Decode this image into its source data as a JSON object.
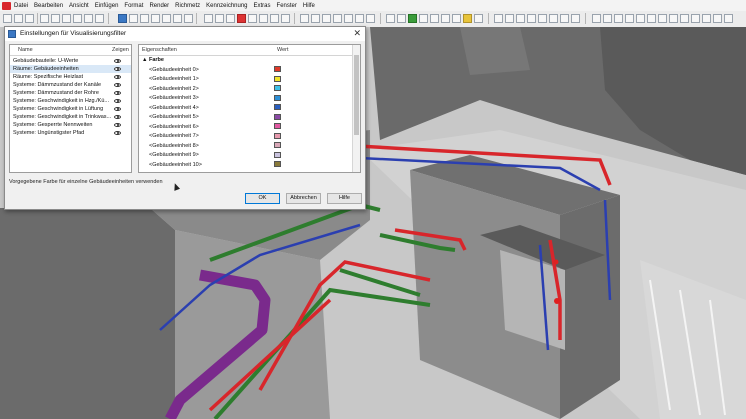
{
  "menu": {
    "items": [
      "Datei",
      "Bearbeiten",
      "Ansicht",
      "Einfügen",
      "Format",
      "Render",
      "Richmetz",
      "Kennzeichnung",
      "Extras",
      "Fenster",
      "Hilfe"
    ]
  },
  "dialog": {
    "title": "Einstellungen für Visualisierungsfilter",
    "close_glyph": "✕",
    "left_panel": {
      "col_name": "Name",
      "col_show": "Zeigen",
      "rows": [
        {
          "label": "Gebäudebauteile: U-Werte",
          "selected": false
        },
        {
          "label": "Räume: Gebäudeeinheiten",
          "selected": true
        },
        {
          "label": "Räume: Spezifische Heizlast",
          "selected": false
        },
        {
          "label": "Systeme: Dämmzustand der Kanäle",
          "selected": false
        },
        {
          "label": "Systeme: Dämmzustand der Rohre",
          "selected": false
        },
        {
          "label": "Systeme: Geschwindigkeit in Hzg./Kü...",
          "selected": false
        },
        {
          "label": "Systeme: Geschwindigkeit in Lüftung",
          "selected": false
        },
        {
          "label": "Systeme: Geschwindigkeit in Trinkwas...",
          "selected": false
        },
        {
          "label": "Systeme: Gesperrte Nennweiten",
          "selected": false
        },
        {
          "label": "Systeme: Ungünstigster Pfad",
          "selected": false
        }
      ]
    },
    "right_panel": {
      "col_props": "Eigenschaften",
      "col_value": "Wert",
      "group": "▲ Farbe",
      "rows": [
        {
          "label": "<Gebäudeeinheit 0>",
          "color": "#e03a2a"
        },
        {
          "label": "<Gebäudeeinheit 1>",
          "color": "#f2e52a"
        },
        {
          "label": "<Gebäudeeinheit 2>",
          "color": "#3fc1e8"
        },
        {
          "label": "<Gebäudeeinheit 3>",
          "color": "#2d8fd6"
        },
        {
          "label": "<Gebäudeeinheit 4>",
          "color": "#2a5fc0"
        },
        {
          "label": "<Gebäudeeinheit 5>",
          "color": "#8b4aa6"
        },
        {
          "label": "<Gebäudeeinheit 6>",
          "color": "#e25aa2"
        },
        {
          "label": "<Gebäudeeinheit 7>",
          "color": "#e79aae"
        },
        {
          "label": "<Gebäudeeinheit 8>",
          "color": "#d9a8b8"
        },
        {
          "label": "<Gebäudeeinheit 9>",
          "color": "#c9c3de"
        },
        {
          "label": "<Gebäudeeinheit 10>",
          "color": "#8a7a3a"
        }
      ]
    },
    "description": "Vorgegebene Farbe für einzelne Gebäudeeinheiten verwenden",
    "buttons": {
      "ok": "OK",
      "cancel": "Abbrechen",
      "help": "Hilfe"
    }
  },
  "colors": {
    "supply_red": "#d8262b",
    "return_blue": "#2b3fb0",
    "vent_green": "#2e7d2e",
    "duct_purple": "#7a2a8c",
    "wall_dark": "#5e5e5e",
    "floor": "#c9c9c9"
  }
}
